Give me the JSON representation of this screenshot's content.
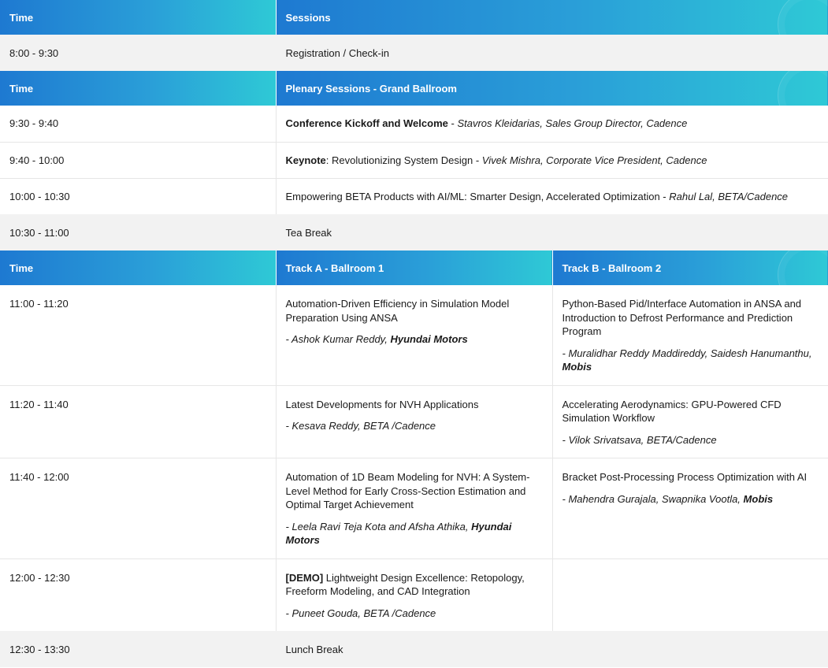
{
  "header1": {
    "time": "Time",
    "sessions": "Sessions"
  },
  "registration": {
    "time": "8:00 - 9:30",
    "label": "Registration / Check-in"
  },
  "header2": {
    "time": "Time",
    "sessions": "Plenary Sessions - Grand Ballroom"
  },
  "plenary": [
    {
      "time": "9:30 - 9:40",
      "title": "Conference Kickoff and Welcome",
      "sep": " - ",
      "speaker": "Stavros Kleidarias, Sales Group Director, Cadence"
    },
    {
      "time": "9:40 - 10:00",
      "title": "Keynote",
      "subtitle": ": Revolutionizing System Design - ",
      "speaker": "Vivek Mishra, Corporate Vice President, Cadence"
    },
    {
      "time": "10:00 - 10:30",
      "title": "Empowering BETA Products with AI/ML: Smarter Design, Accelerated Optimization - ",
      "speaker": "Rahul Lal, BETA/Cadence"
    }
  ],
  "tea_break": {
    "time": "10:30 - 11:00",
    "label": "Tea Break"
  },
  "header3": {
    "time": "Time",
    "track_a": "Track A - Ballroom 1",
    "track_b": "Track B - Ballroom 2"
  },
  "tracks": [
    {
      "time": "11:00 - 11:20",
      "a": {
        "title": "Automation-Driven Efficiency in Simulation Model Preparation Using ANSA",
        "speaker": "- Ashok Kumar Reddy, ",
        "company": "Hyundai Motors"
      },
      "b": {
        "title": "Python-Based Pid/Interface Automation in ANSA and Introduction to Defrost Performance and Prediction Program",
        "speaker": "- Muralidhar Reddy Maddireddy, Saidesh Hanumanthu, ",
        "company": "Mobis"
      }
    },
    {
      "time": "11:20 - 11:40",
      "a": {
        "title": "Latest Developments for NVH Applications",
        "speaker": "- Kesava Reddy, BETA /Cadence"
      },
      "b": {
        "title": "Accelerating Aerodynamics: GPU-Powered CFD Simulation Workflow",
        "speaker": "- Vilok Srivatsava, BETA/Cadence"
      }
    },
    {
      "time": "11:40 - 12:00",
      "a": {
        "title": "Automation of 1D Beam Modeling for NVH: A System-Level Method for Early Cross-Section Estimation and Optimal Target Achievement",
        "speaker": "- Leela Ravi Teja Kota and Afsha Athika, ",
        "company": "Hyundai Motors"
      },
      "b": {
        "title": "Bracket Post-Processing Process Optimization with AI",
        "speaker": "- Mahendra Gurajala, Swapnika Vootla, ",
        "company": "Mobis"
      }
    },
    {
      "time": "12:00 - 12:30",
      "a": {
        "tag": "[DEMO]",
        "title": " Lightweight Design Excellence: Retopology, Freeform Modeling, and CAD Integration",
        "speaker": "- Puneet Gouda, BETA /Cadence"
      }
    }
  ],
  "lunch": {
    "time": "12:30 - 13:30",
    "label": "Lunch Break"
  }
}
